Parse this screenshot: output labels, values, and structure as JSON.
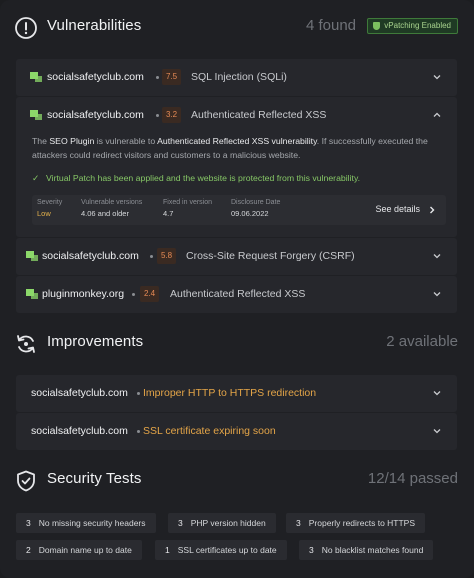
{
  "colors": {
    "accent_green": "#86c766",
    "warning_orange": "#e58a55",
    "improvement_amber": "#e4a548"
  },
  "vulnerabilities": {
    "title": "Vulnerabilities",
    "count": "4 found",
    "vpatch_badge": "vPatching Enabled",
    "items": [
      {
        "site": "socialsafetyclub.com",
        "score": "7.5",
        "title": "SQL Injection (SQLi)",
        "expanded": false
      },
      {
        "site": "socialsafetyclub.com",
        "score": "3.2",
        "title": "Authenticated Reflected XSS",
        "expanded": true,
        "desc_pre": "The ",
        "desc_plugin": "SEO Plugin",
        "desc_mid": " is vulnerable to ",
        "desc_vuln": "Authenticated Reflected XSS vulnerability",
        "desc_post": ". If successfully executed the attackers could redirect visitors and customers to a malicious website.",
        "applied": "Virtual Patch has been applied and the website is protected from this vulnerability.",
        "details": {
          "severity_label": "Severity",
          "severity_value": "Low",
          "versions_label": "Vulnerable versions",
          "versions_value": "4.06 and older",
          "fixed_label": "Fixed in version",
          "fixed_value": "4.7",
          "disclosure_label": "Disclosure Date",
          "disclosure_value": "09.06.2022",
          "see_details": "See details"
        }
      },
      {
        "site": "socialsafetyclub.com",
        "score": "5.8",
        "title": "Cross-Site Request Forgery (CSRF)",
        "expanded": false
      },
      {
        "site": "pluginmonkey.org",
        "score": "2.4",
        "title": "Authenticated Reflected XSS",
        "expanded": false
      }
    ]
  },
  "improvements": {
    "title": "Improvements",
    "count": "2 available",
    "items": [
      {
        "site": "socialsafetyclub.com",
        "title": "Improper HTTP to HTTPS redirection"
      },
      {
        "site": "socialsafetyclub.com",
        "title": "SSL certificate expiring soon"
      }
    ]
  },
  "security_tests": {
    "title": "Security Tests",
    "count": "12/14 passed",
    "tags": [
      {
        "n": "3",
        "label": "No missing security headers"
      },
      {
        "n": "3",
        "label": "PHP version hidden"
      },
      {
        "n": "3",
        "label": "Properly redirects to HTTPS"
      },
      {
        "n": "2",
        "label": "Domain name up to date"
      },
      {
        "n": "1",
        "label": "SSL certificates up to date"
      },
      {
        "n": "3",
        "label": "No blacklist matches found"
      }
    ]
  },
  "icons": {
    "vulnerabilities": "alert-circle-icon",
    "improvements": "refresh-icon",
    "security_tests": "shield-check-icon",
    "site": "site-logo-icon",
    "chevron_down": "chevron-down-icon",
    "chevron_up": "chevron-up-icon",
    "chevron_right": "chevron-right-icon",
    "check": "check-icon"
  }
}
